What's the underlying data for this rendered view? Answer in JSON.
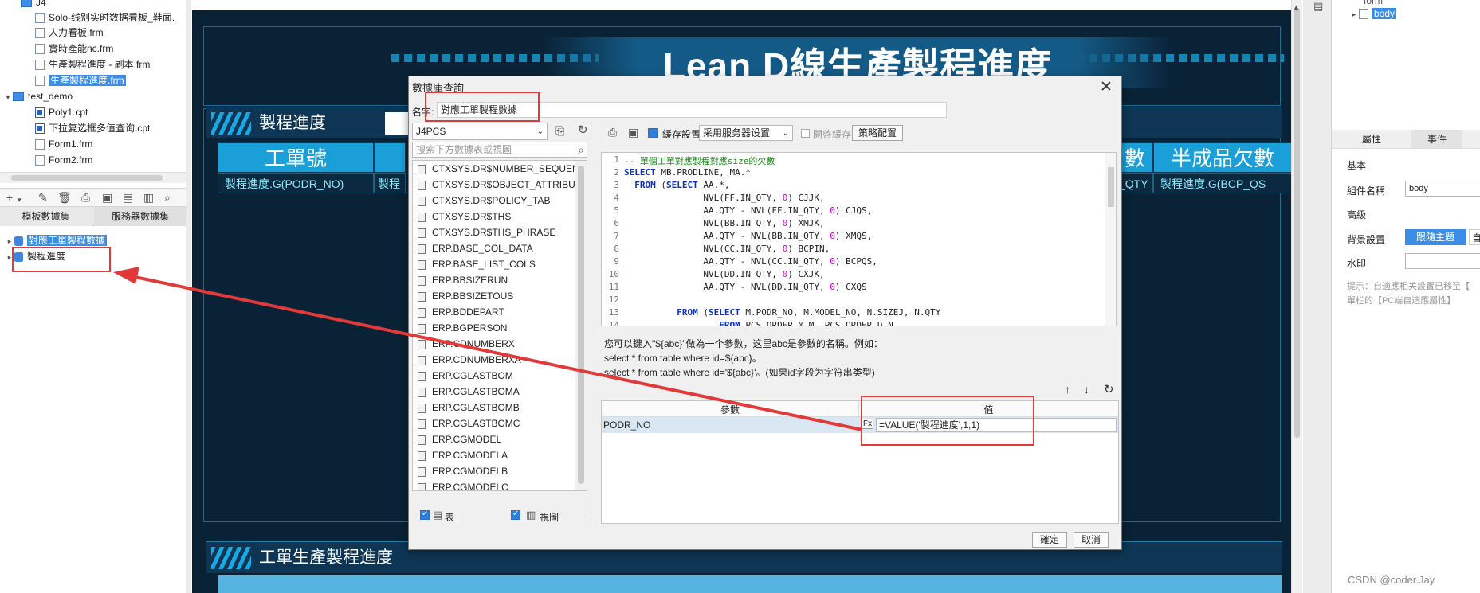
{
  "tree": {
    "folder_j4": "J4",
    "items_j4": [
      "Solo-线别实时数据看板_鞋面.",
      "人力看板.frm",
      "實時產能nc.frm",
      "生產製程進度 - 副本.frm",
      "生產製程進度.frm"
    ],
    "folder_test": "test_demo",
    "items_test": [
      "Poly1.cpt",
      "下拉复选框多值查询.cpt",
      "Form1.frm",
      "Form2.frm"
    ]
  },
  "datasets": {
    "tab_template": "模板數據集",
    "tab_server": "服務器數據集",
    "items": [
      "對應工單製程數據",
      "製程進度"
    ]
  },
  "dashboard": {
    "title": "Lean D線生產製程進度",
    "section1": "製程進度",
    "section2": "工單生產製程進度",
    "headers": [
      "工單號",
      "",
      "數",
      "半成品欠數"
    ],
    "cells": [
      "製程進度.G(PODR_NO)",
      "製程",
      "_QTY",
      "製程進度.G(BCP_QS"
    ]
  },
  "right_panel": {
    "tree_top": "form",
    "tree_body": "body",
    "tab_props": "屬性",
    "tab_events": "事件",
    "section_basic": "基本",
    "comp_name_label": "組件名稱",
    "comp_name_value": "body",
    "section_advanced": "高級",
    "bg_label": "背景設置",
    "bg_button": "跟隨主題",
    "bg_button2": "自",
    "watermark_label": "水印",
    "hint": "提示：自適應相关設置已移至【",
    "hint2": "單栏的【PC端自適應屬性】"
  },
  "dialog": {
    "title": "數據庫查詢",
    "name_label": "名字:",
    "name_value": "對應工單製程數據",
    "connection": "J4PCS",
    "search_placeholder": "搜索下方數據表或視圖",
    "tables": [
      "CTXSYS.DR$NUMBER_SEQUENCE",
      "CTXSYS.DR$OBJECT_ATTRIBUTE",
      "CTXSYS.DR$POLICY_TAB",
      "CTXSYS.DR$THS",
      "CTXSYS.DR$THS_PHRASE",
      "ERP.BASE_COL_DATA",
      "ERP.BASE_LIST_COLS",
      "ERP.BBSIZERUN",
      "ERP.BBSIZETOUS",
      "ERP.BDDEPART",
      "ERP.BGPERSON",
      "ERP.CDNUMBERX",
      "ERP.CDNUMBERXA",
      "ERP.CGLASTBOM",
      "ERP.CGLASTBOMA",
      "ERP.CGLASTBOMB",
      "ERP.CGLASTBOMC",
      "ERP.CGMODEL",
      "ERP.CGMODELA",
      "ERP.CGMODELB",
      "ERP.CGMODELC"
    ],
    "check_table": "表",
    "check_view": "視圖",
    "cache_label": "緩存設置",
    "cache_value": "采用服务器设置",
    "enable_cache": "開啓緩存",
    "strategy_button": "策略配置",
    "sql_lines": [
      "-- 單個工單對應製程對應size的欠數",
      "SELECT MB.PRODLINE, MA.*",
      "  FROM (SELECT AA.*,",
      "               NVL(FF.IN_QTY, 0) CJJK,",
      "               AA.QTY - NVL(FF.IN_QTY, 0) CJQS,",
      "               NVL(BB.IN_QTY, 0) XMJK,",
      "               AA.QTY - NVL(BB.IN_QTY, 0) XMQS,",
      "               NVL(CC.IN_QTY, 0) BCPIN,",
      "               AA.QTY - NVL(CC.IN_QTY, 0) BCPQS,",
      "               NVL(DD.IN_QTY, 0) CXJK,",
      "               AA.QTY - NVL(DD.IN_QTY, 0) CXQS",
      "",
      "          FROM (SELECT M.PODR_NO, M.MODEL_NO, N.SIZEJ, N.QTY",
      "                  FROM PCS_ORDER_M M, PCS_ORDER_D N"
    ],
    "help_line1": "您可以鍵入\"${abc}\"做為一个參數，这里abc是參數的名稱。例如：",
    "help_line2": "select * from table where id=${abc}。",
    "help_line3": "select * from table where id='${abc}'。(如果id字段为字符串类型)",
    "param_header": "參數",
    "value_header": "值",
    "param_name": "PODR_NO",
    "param_value": "=VALUE('製程進度',1,1)",
    "ok": "確定",
    "cancel": "取消"
  },
  "watermark": "CSDN @coder.Jay"
}
